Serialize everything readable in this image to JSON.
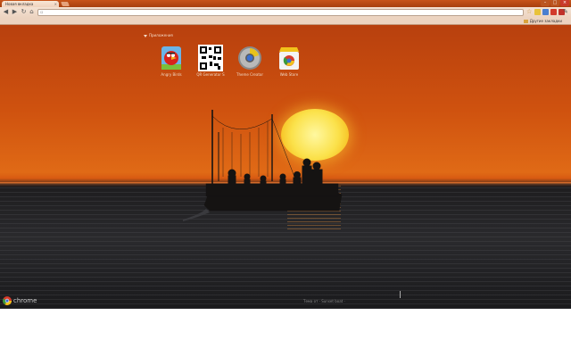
{
  "tab": {
    "title": "Новая вкладка",
    "close": "×"
  },
  "window_controls": {
    "minimize": "–",
    "maximize": "□",
    "close": "×"
  },
  "toolbar": {
    "back": "◀",
    "forward": "▶",
    "reload": "↻",
    "home": "⌂",
    "url": ""
  },
  "bookmarks": {
    "other": "Другие закладки"
  },
  "apps_section": {
    "label": "Приложения"
  },
  "apps": [
    {
      "label": "Angry Birds",
      "icon": "angry-birds-icon"
    },
    {
      "label": "QR Generator S",
      "icon": "qr-code-icon"
    },
    {
      "label": "Theme Creator",
      "icon": "theme-creator-icon"
    },
    {
      "label": "Web Store",
      "icon": "web-store-icon"
    }
  ],
  "footer": {
    "brand": "chrome",
    "attribution": "Тема от · Sunset boat ·"
  },
  "colors": {
    "frame": "#c8541a",
    "sky": "#d85a12",
    "sun": "#fbe14a",
    "sea": "#1e1d1f"
  }
}
